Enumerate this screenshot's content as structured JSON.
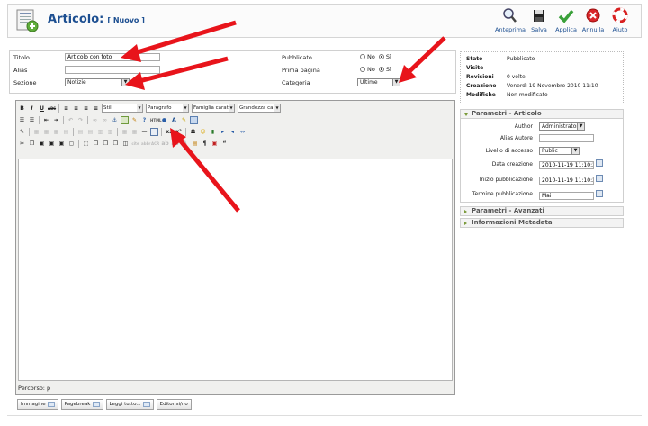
{
  "header": {
    "title": "Articolo:",
    "subtitle": "[ Nuovo ]",
    "buttons": [
      {
        "label": "Anteprima",
        "icon": "magnifier-icon"
      },
      {
        "label": "Salva",
        "icon": "floppy-disk-icon"
      },
      {
        "label": "Applica",
        "icon": "checkmark-icon"
      },
      {
        "label": "Annulla",
        "icon": "cancel-icon"
      },
      {
        "label": "Aiuto",
        "icon": "lifebuoy-icon"
      }
    ]
  },
  "form": {
    "titolo_label": "Titolo",
    "titolo_value": "Articolo con foto",
    "alias_label": "Alias",
    "alias_value": "",
    "sezione_label": "Sezione",
    "sezione_value": "Notizie",
    "pubblicato_label": "Pubblicato",
    "prima_pagina_label": "Prima pagina",
    "categoria_label": "Categoria",
    "categoria_value": "Ultime",
    "radio_no": "No",
    "radio_si": "Sì"
  },
  "editor": {
    "stili": "Stili",
    "paragrafo": "Paragrafo",
    "famiglia": "Famiglia caratt",
    "grandezza": "Grandezza car",
    "path_label": "Percorso: p",
    "buttons": {
      "immagine": "Immagine",
      "pagebreak": "Pagebreak",
      "leggi_tutto": "Leggi tutto...",
      "editor_si_no": "Editor si/no"
    }
  },
  "info": {
    "rows": [
      {
        "label": "Stato",
        "value": "Pubblicato"
      },
      {
        "label": "Visite",
        "value": ""
      },
      {
        "label": "Revisioni",
        "value": "0 volte"
      },
      {
        "label": "Creazione",
        "value": "Venerdì 19 Novembre 2010 11:10"
      },
      {
        "label": "Modifiche",
        "value": "Non modificato"
      }
    ]
  },
  "params": {
    "section_article": "Parametri - Articolo",
    "section_advanced": "Parametri - Avanzati",
    "section_metadata": "Informazioni Metadata",
    "author_label": "Author",
    "author_value": "Administrator",
    "alias_autore_label": "Alias Autore",
    "alias_autore_value": "",
    "livello_label": "Livello di accesso",
    "livello_value": "Public",
    "data_creazione_label": "Data creazione",
    "data_creazione_value": "2010-11-19 11:10:24",
    "inizio_label": "Inizio pubblicazione",
    "inizio_value": "2010-11-19 11:10:24",
    "termine_label": "Termine pubblicazione",
    "termine_value": "Mai"
  },
  "colors": {
    "title_blue": "#1d4f91",
    "arrow_red": "#e8141b",
    "accent_green": "#7a9a3a"
  }
}
